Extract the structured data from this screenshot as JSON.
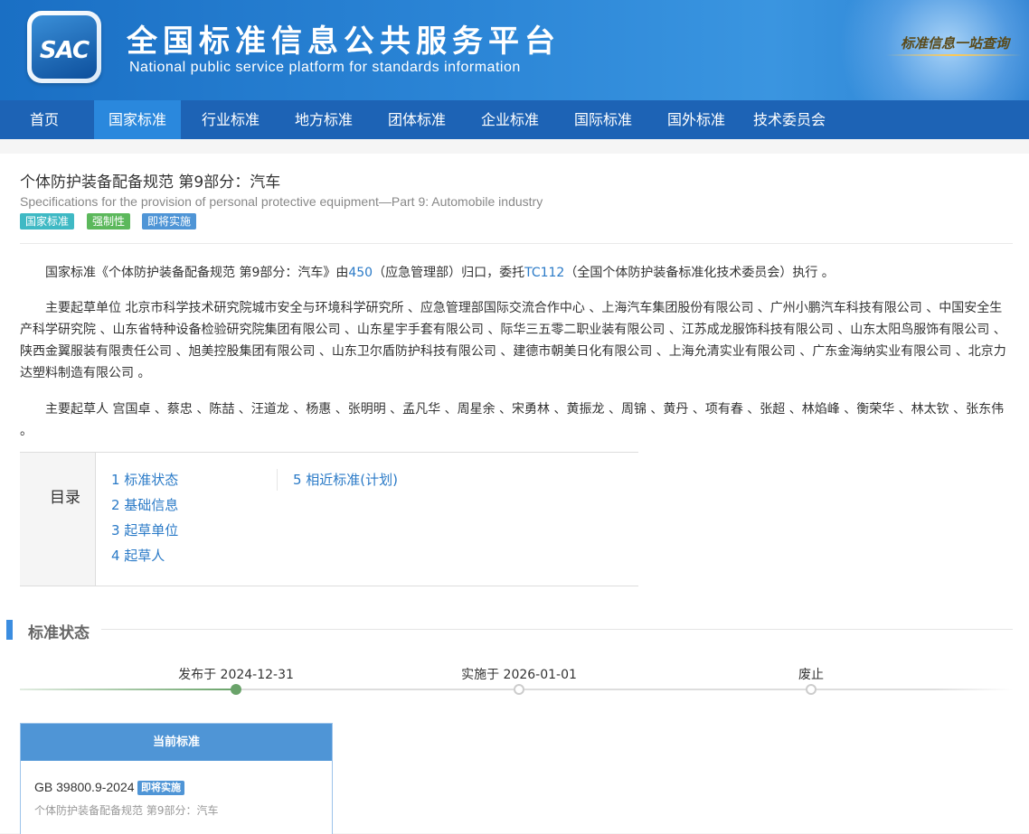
{
  "header": {
    "logo_text": "SAC",
    "title": "全国标准信息公共服务平台",
    "subtitle": "National public service platform  for standards information",
    "slogan": "标准信息一站查询"
  },
  "nav": {
    "items": [
      "首页",
      "国家标准",
      "行业标准",
      "地方标准",
      "团体标准",
      "企业标准",
      "国际标准",
      "国外标准",
      "技术委员会"
    ],
    "active_index": 1
  },
  "standard": {
    "title_cn": "个体防护装备配备规范 第9部分：汽车",
    "title_en": "Specifications for the provision of personal protective equipment—Part 9: Automobile industry",
    "badges": [
      {
        "label": "国家标准",
        "color": "#3fb9c4"
      },
      {
        "label": "强制性",
        "color": "#5cb85c"
      },
      {
        "label": "即将实施",
        "color": "#4f95d6"
      }
    ]
  },
  "intro": {
    "p1_a": "国家标准《个体防护装备配备规范 第9部分：汽车》由",
    "p1_link1": "450",
    "p1_b": "（应急管理部）归口，委托",
    "p1_link2": "TC112",
    "p1_c": "（全国个体防护装备标准化技术委员会）执行 。",
    "p2": "主要起草单位 北京市科学技术研究院城市安全与环境科学研究所 、应急管理部国际交流合作中心 、上海汽车集团股份有限公司 、广州小鹏汽车科技有限公司 、中国安全生产科学研究院 、山东省特种设备检验研究院集团有限公司 、山东星宇手套有限公司 、际华三五零二职业装有限公司 、江苏成龙服饰科技有限公司 、山东太阳鸟服饰有限公司 、陕西金翼服装有限责任公司 、旭美控股集团有限公司 、山东卫尔盾防护科技有限公司 、建德市朝美日化有限公司 、上海允清实业有限公司 、广东金海纳实业有限公司 、北京力达塑料制造有限公司 。",
    "p3": "主要起草人 宫国卓 、蔡忠 、陈喆 、汪道龙 、杨惠 、张明明 、孟凡华 、周星余 、宋勇林 、黄振龙 、周锦 、黄丹 、项有春 、张超 、林焰峰 、衡荣华 、林太钦 、张东伟 。"
  },
  "toc": {
    "heading": "目录",
    "items": [
      "1  标准状态",
      "2  基础信息",
      "3  起草单位",
      "4  起草人",
      "5  相近标准(计划)"
    ]
  },
  "status_section": {
    "title": "标准状态",
    "timeline": [
      {
        "label": "发布于 2024-12-31",
        "done": true
      },
      {
        "label": "实施于 2026-01-01",
        "done": false
      },
      {
        "label": "废止",
        "done": false
      }
    ],
    "colors": {
      "done": "#6aa36a",
      "pending": "#cccccc"
    }
  },
  "current": {
    "heading": "当前标准",
    "code": "GB 39800.9-2024",
    "badge": "即将实施",
    "name": "个体防护装备配备规范 第9部分：汽车"
  }
}
